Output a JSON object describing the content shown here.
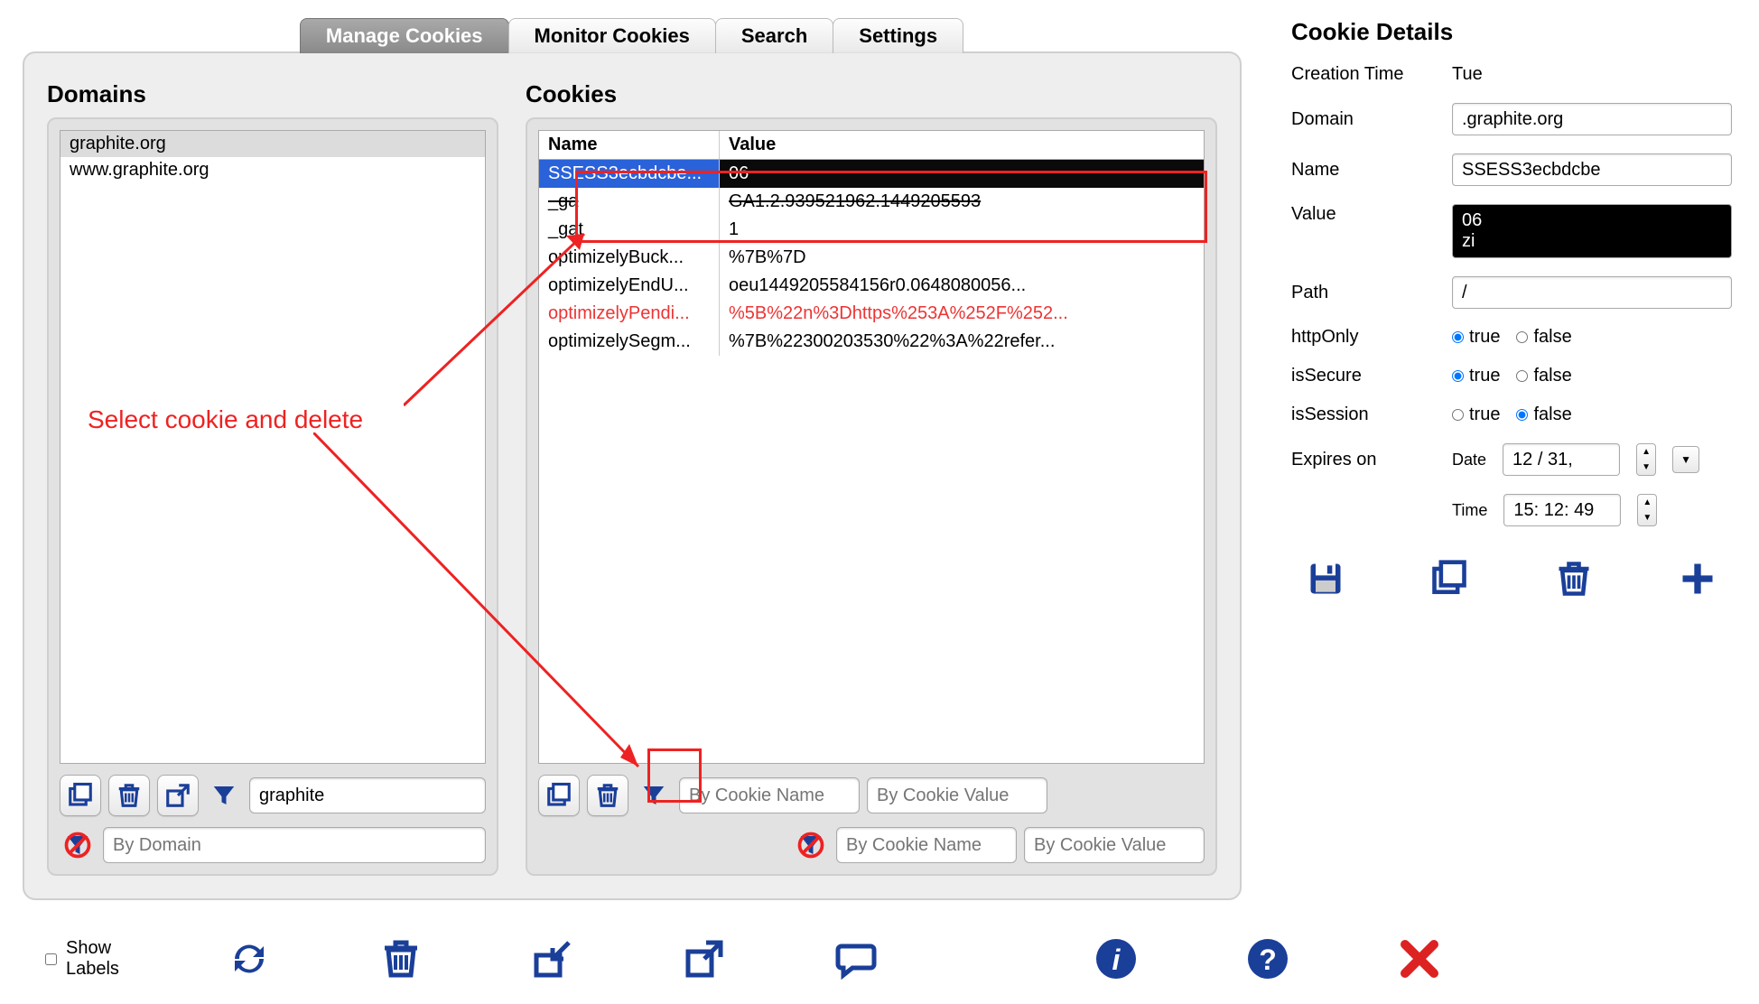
{
  "tabs": {
    "manage": "Manage Cookies",
    "monitor": "Monitor Cookies",
    "search": "Search",
    "settings": "Settings"
  },
  "domainsPanel": {
    "title": "Domains",
    "items": [
      "graphite.org",
      "www.graphite.org"
    ],
    "filterValue": "graphite",
    "excludePlaceholder": "By Domain"
  },
  "cookiesPanel": {
    "title": "Cookies",
    "columns": {
      "name": "Name",
      "value": "Value"
    },
    "rows": [
      {
        "name": "SSESS3ecbdcbe...",
        "value": "06",
        "selected": true
      },
      {
        "name": "_ga",
        "value": "GA1.2.939521962.1449205593",
        "striked": true
      },
      {
        "name": "_gat",
        "value": "1"
      },
      {
        "name": "optimizelyBuck...",
        "value": "%7B%7D"
      },
      {
        "name": "optimizelyEndU...",
        "value": "oeu1449205584156r0.0648080056..."
      },
      {
        "name": "optimizelyPendi...",
        "value": "%5B%22n%3Dhttps%253A%252F%252...",
        "warn": true
      },
      {
        "name": "optimizelySegm...",
        "value": "%7B%22300203530%22%3A%22refer..."
      }
    ],
    "nameFilterPlaceholder": "By Cookie Name",
    "valueFilterPlaceholder": "By Cookie Value",
    "nameExcludePlaceholder": "By Cookie Name",
    "valueExcludePlaceholder": "By Cookie Value"
  },
  "details": {
    "title": "Cookie Details",
    "labels": {
      "creationTime": "Creation Time",
      "domain": "Domain",
      "name": "Name",
      "value": "Value",
      "path": "Path",
      "httpOnly": "httpOnly",
      "isSecure": "isSecure",
      "isSession": "isSession",
      "expiresOn": "Expires on",
      "date": "Date",
      "time": "Time",
      "trueLabel": "true",
      "falseLabel": "false"
    },
    "values": {
      "creationTime": "Tue",
      "domain": ".graphite.org",
      "name": "SSESS3ecbdcbe",
      "value": "06\nzi",
      "path": "/",
      "httpOnly": "true",
      "isSecure": "true",
      "isSession": "false",
      "date": "12 / 31,",
      "time": "15: 12: 49"
    }
  },
  "bottom": {
    "showLabels": "Show Labels"
  },
  "annotation": {
    "text": "Select cookie and delete"
  }
}
